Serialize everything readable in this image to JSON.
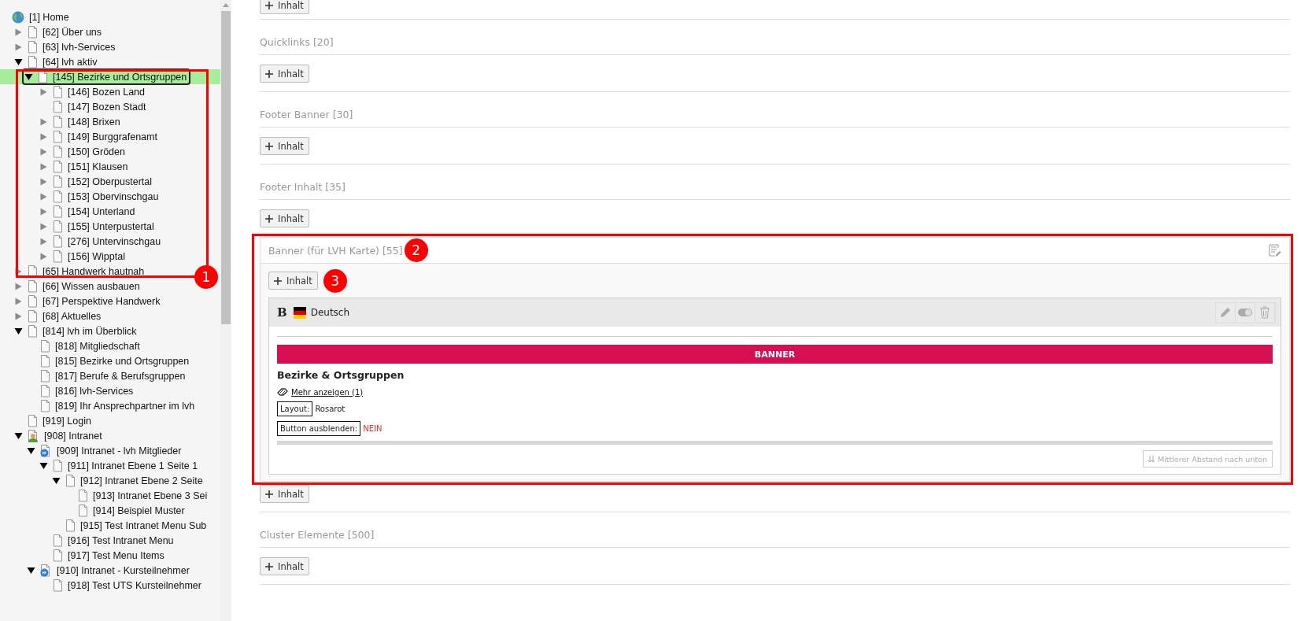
{
  "tree": [
    {
      "label": "[1] Home",
      "kind": "globe",
      "selected": false,
      "children": [
        {
          "label": "[62] Über uns",
          "kind": "page",
          "expanded": false,
          "selected": false
        },
        {
          "label": "[63] lvh-Services",
          "kind": "page",
          "expanded": false,
          "selected": false
        },
        {
          "label": "[64] lvh aktiv",
          "kind": "page",
          "expanded": true,
          "selected": false,
          "children": [
            {
              "label": "[145] Bezirke und Ortsgruppen",
              "kind": "page",
              "expanded": true,
              "selected": true,
              "children": [
                {
                  "label": "[146] Bozen Land",
                  "kind": "page",
                  "expanded": false,
                  "selected": false
                },
                {
                  "label": "[147] Bozen Stadt",
                  "kind": "page",
                  "selected": false
                },
                {
                  "label": "[148] Brixen",
                  "kind": "page",
                  "expanded": false,
                  "selected": false
                },
                {
                  "label": "[149] Burggrafenamt",
                  "kind": "page",
                  "expanded": false,
                  "selected": false
                },
                {
                  "label": "[150] Gröden",
                  "kind": "page",
                  "expanded": false,
                  "selected": false
                },
                {
                  "label": "[151] Klausen",
                  "kind": "page",
                  "expanded": false,
                  "selected": false
                },
                {
                  "label": "[152] Oberpustertal",
                  "kind": "page",
                  "expanded": false,
                  "selected": false
                },
                {
                  "label": "[153] Obervinschgau",
                  "kind": "page",
                  "expanded": false,
                  "selected": false
                },
                {
                  "label": "[154] Unterland",
                  "kind": "page",
                  "expanded": false,
                  "selected": false
                },
                {
                  "label": "[155] Unterpustertal",
                  "kind": "page",
                  "expanded": false,
                  "selected": false
                },
                {
                  "label": "[276] Untervinschgau",
                  "kind": "page",
                  "expanded": false,
                  "selected": false
                },
                {
                  "label": "[156] Wipptal",
                  "kind": "page",
                  "expanded": false,
                  "selected": false
                }
              ]
            }
          ]
        },
        {
          "label": "[65] Handwerk hautnah",
          "kind": "page",
          "expanded": false,
          "selected": false
        },
        {
          "label": "[66] Wissen ausbauen",
          "kind": "page",
          "expanded": false,
          "selected": false
        },
        {
          "label": "[67] Perspektive Handwerk",
          "kind": "page",
          "expanded": false,
          "selected": false
        },
        {
          "label": "[68] Aktuelles",
          "kind": "page",
          "expanded": false,
          "selected": false
        },
        {
          "label": "[814] lvh im Überblick",
          "kind": "page",
          "expanded": true,
          "selected": false,
          "children": [
            {
              "label": "[818] Mitgliedschaft",
              "kind": "page",
              "selected": false
            },
            {
              "label": "[815] Bezirke und Ortsgruppen",
              "kind": "page",
              "selected": false
            },
            {
              "label": "[817] Berufe & Berufsgruppen",
              "kind": "page",
              "selected": false
            },
            {
              "label": "[816] lvh-Services",
              "kind": "page",
              "selected": false
            },
            {
              "label": "[819] Ihr Ansprechpartner im lvh",
              "kind": "page",
              "selected": false
            }
          ]
        },
        {
          "label": "[919] Login",
          "kind": "page",
          "selected": false
        },
        {
          "label": "[908] Intranet",
          "kind": "user-page",
          "expanded": true,
          "selected": false,
          "children": [
            {
              "label": "[909] Intranet - lvh Mitglieder",
              "kind": "shortcut-page",
              "expanded": true,
              "selected": false,
              "children": [
                {
                  "label": "[911] Intranet Ebene 1 Seite 1",
                  "kind": "page",
                  "expanded": true,
                  "selected": false,
                  "children": [
                    {
                      "label": "[912] Intranet Ebene 2 Seite",
                      "kind": "page",
                      "expanded": true,
                      "selected": false,
                      "children": [
                        {
                          "label": "[913] Intranet Ebene 3 Sei",
                          "kind": "page",
                          "selected": false
                        },
                        {
                          "label": "[914] Beispiel Muster",
                          "kind": "page",
                          "selected": false
                        }
                      ]
                    },
                    {
                      "label": "[915] Test Intranet Menu Sub",
                      "kind": "page",
                      "selected": false
                    }
                  ]
                },
                {
                  "label": "[916] Test Intranet Menu",
                  "kind": "page",
                  "selected": false
                },
                {
                  "label": "[917] Test Menu Items",
                  "kind": "page",
                  "selected": false
                }
              ]
            },
            {
              "label": "[910] Intranet - Kursteilnehmer",
              "kind": "shortcut-page",
              "expanded": true,
              "selected": false,
              "children": [
                {
                  "label": "[918] Test UTS Kursteilnehmer",
                  "kind": "page",
                  "selected": false
                }
              ]
            }
          ]
        }
      ]
    }
  ],
  "sections": [
    {
      "kind": "partial",
      "add_button": "Inhalt"
    },
    {
      "kind": "plain",
      "title": "Quicklinks [20]",
      "add_button": "Inhalt"
    },
    {
      "kind": "plain",
      "title": "Footer Banner [30]",
      "add_button": "Inhalt"
    },
    {
      "kind": "plain",
      "title": "Footer Inhalt [35]",
      "add_button": "Inhalt"
    },
    {
      "kind": "elements",
      "title": "Banner (für LVH Karte) [55]",
      "add_button": "Inhalt",
      "after_button": "Inhalt",
      "elements": [
        {
          "type_letter": "B",
          "language": "Deutsch",
          "banner_label": "BANNER",
          "heading": "Bezirke & Ortsgruppen",
          "link": "Mehr anzeigen (1)",
          "fields": [
            {
              "label": "Layout:",
              "value": "Rosarot",
              "kind": "plain"
            },
            {
              "label": "Button ausblenden:",
              "value": "NEIN",
              "kind": "negative"
            }
          ],
          "spacing_button": "Mittlerer Abstand nach unten"
        }
      ]
    },
    {
      "kind": "plain",
      "title": "Cluster Elemente [500]",
      "add_button": "Inhalt"
    }
  ],
  "annotations": [
    {
      "label": "1"
    },
    {
      "label": "2"
    },
    {
      "label": "3"
    }
  ]
}
